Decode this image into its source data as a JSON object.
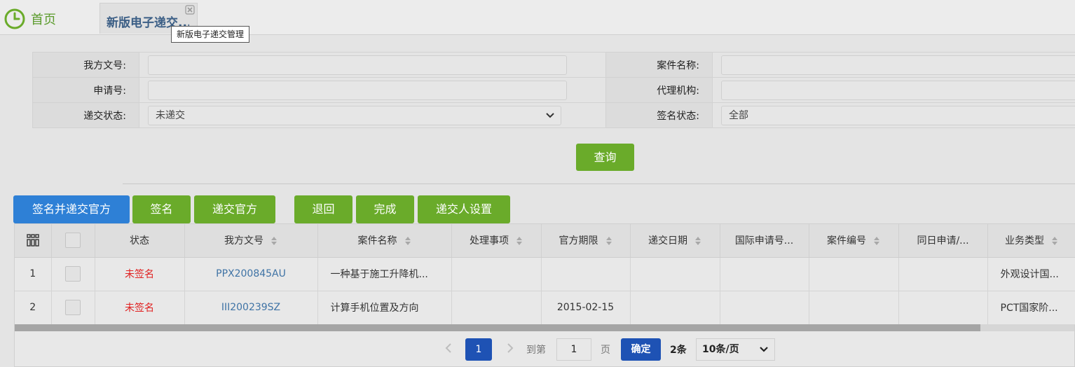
{
  "tabs": {
    "home_label": "首页",
    "active_label": "新版电子递交...",
    "tooltip": "新版电子递交管理"
  },
  "form": {
    "our_ref_label": "我方文号:",
    "case_name_label": "案件名称:",
    "app_no_label": "申请号:",
    "agency_label": "代理机构:",
    "submit_status_label": "递交状态:",
    "submit_status_value": "未递交",
    "sign_status_label": "签名状态:",
    "sign_status_value": "全部",
    "query_button": "查询"
  },
  "toolbar": {
    "sign_and_submit": "签名并递交官方",
    "sign": "签名",
    "submit_official": "递交官方",
    "return": "退回",
    "complete": "完成",
    "submitter_settings": "递交人设置"
  },
  "table": {
    "headers": {
      "status": "状态",
      "our_ref": "我方文号",
      "case_name": "案件名称",
      "matter": "处理事项",
      "deadline": "官方期限",
      "submit_date": "递交日期",
      "intl_app_no": "国际申请号...",
      "case_no": "案件编号",
      "same_day": "同日申请/...",
      "biz_type": "业务类型"
    },
    "rows": [
      {
        "index": "1",
        "status": "未签名",
        "our_ref": "PPX200845AU",
        "case_name": "一种基于施工升降机...",
        "matter": "",
        "deadline": "",
        "submit_date": "",
        "intl_app_no": "",
        "case_no": "",
        "same_day": "",
        "biz_type": "外观设计国..."
      },
      {
        "index": "2",
        "status": "未签名",
        "our_ref": "III200239SZ",
        "case_name": "计算手机位置及方向",
        "matter": "",
        "deadline": "2015-02-15",
        "submit_date": "",
        "intl_app_no": "",
        "case_no": "",
        "same_day": "",
        "biz_type": "PCT国家阶..."
      }
    ]
  },
  "pager": {
    "current_page": "1",
    "goto_label": "到第",
    "goto_value": "1",
    "page_unit": "页",
    "confirm": "确定",
    "total": "2条",
    "page_size": "10条/页"
  },
  "colors": {
    "accent_green": "#6aab2a",
    "accent_blue": "#2e80d6",
    "pager_blue": "#1e52b4",
    "status_red": "#e02020"
  }
}
